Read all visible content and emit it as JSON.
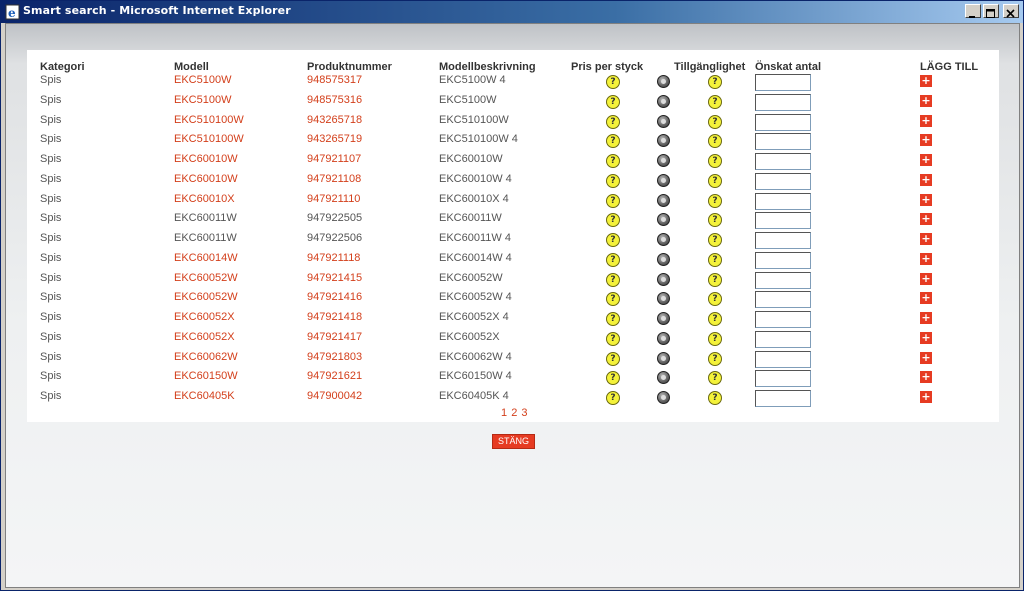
{
  "window": {
    "title": "Smart search - Microsoft Internet Explorer"
  },
  "table": {
    "headers": {
      "kategori": "Kategori",
      "modell": "Modell",
      "produktnummer": "Produktnummer",
      "modellbeskrivning": "Modellbeskrivning",
      "pris": "Pris per styck",
      "tillganglighet": "Tillgänglighet",
      "antal": "Önskat antal",
      "lagg_till": "LÄGG TILL"
    },
    "rows": [
      {
        "kategori": "Spis",
        "modell": "EKC5100W",
        "produktnummer": "948575317",
        "beskrivning": "EKC5100W 4",
        "link": true
      },
      {
        "kategori": "Spis",
        "modell": "EKC5100W",
        "produktnummer": "948575316",
        "beskrivning": "EKC5100W",
        "link": true
      },
      {
        "kategori": "Spis",
        "modell": "EKC510100W",
        "produktnummer": "943265718",
        "beskrivning": "EKC510100W",
        "link": true
      },
      {
        "kategori": "Spis",
        "modell": "EKC510100W",
        "produktnummer": "943265719",
        "beskrivning": "EKC510100W 4",
        "link": true
      },
      {
        "kategori": "Spis",
        "modell": "EKC60010W",
        "produktnummer": "947921107",
        "beskrivning": "EKC60010W",
        "link": true
      },
      {
        "kategori": "Spis",
        "modell": "EKC60010W",
        "produktnummer": "947921108",
        "beskrivning": "EKC60010W 4",
        "link": true
      },
      {
        "kategori": "Spis",
        "modell": "EKC60010X",
        "produktnummer": "947921110",
        "beskrivning": "EKC60010X 4",
        "link": true
      },
      {
        "kategori": "Spis",
        "modell": "EKC60011W",
        "produktnummer": "947922505",
        "beskrivning": "EKC60011W",
        "link": false
      },
      {
        "kategori": "Spis",
        "modell": "EKC60011W",
        "produktnummer": "947922506",
        "beskrivning": "EKC60011W 4",
        "link": false
      },
      {
        "kategori": "Spis",
        "modell": "EKC60014W",
        "produktnummer": "947921118",
        "beskrivning": "EKC60014W 4",
        "link": true
      },
      {
        "kategori": "Spis",
        "modell": "EKC60052W",
        "produktnummer": "947921415",
        "beskrivning": "EKC60052W",
        "link": true
      },
      {
        "kategori": "Spis",
        "modell": "EKC60052W",
        "produktnummer": "947921416",
        "beskrivning": "EKC60052W 4",
        "link": true
      },
      {
        "kategori": "Spis",
        "modell": "EKC60052X",
        "produktnummer": "947921418",
        "beskrivning": "EKC60052X 4",
        "link": true
      },
      {
        "kategori": "Spis",
        "modell": "EKC60052X",
        "produktnummer": "947921417",
        "beskrivning": "EKC60052X",
        "link": true
      },
      {
        "kategori": "Spis",
        "modell": "EKC60062W",
        "produktnummer": "947921803",
        "beskrivning": "EKC60062W 4",
        "link": true
      },
      {
        "kategori": "Spis",
        "modell": "EKC60150W",
        "produktnummer": "947921621",
        "beskrivning": "EKC60150W 4",
        "link": true
      },
      {
        "kategori": "Spis",
        "modell": "EKC60405K",
        "produktnummer": "947900042",
        "beskrivning": "EKC60405K 4",
        "link": true
      }
    ],
    "question_glyph": "?",
    "add_glyph": "+"
  },
  "pager": {
    "pages": [
      "1",
      "2",
      "3"
    ]
  },
  "close_button": {
    "label": "STÄNG"
  },
  "colors": {
    "link_red": "#d33f1b",
    "button_red": "#e63b22",
    "title_blue": "#0a246a"
  },
  "icons": {
    "price": "help-question-icon",
    "info": "info-icon",
    "availability": "help-question-icon",
    "add": "plus-icon"
  }
}
